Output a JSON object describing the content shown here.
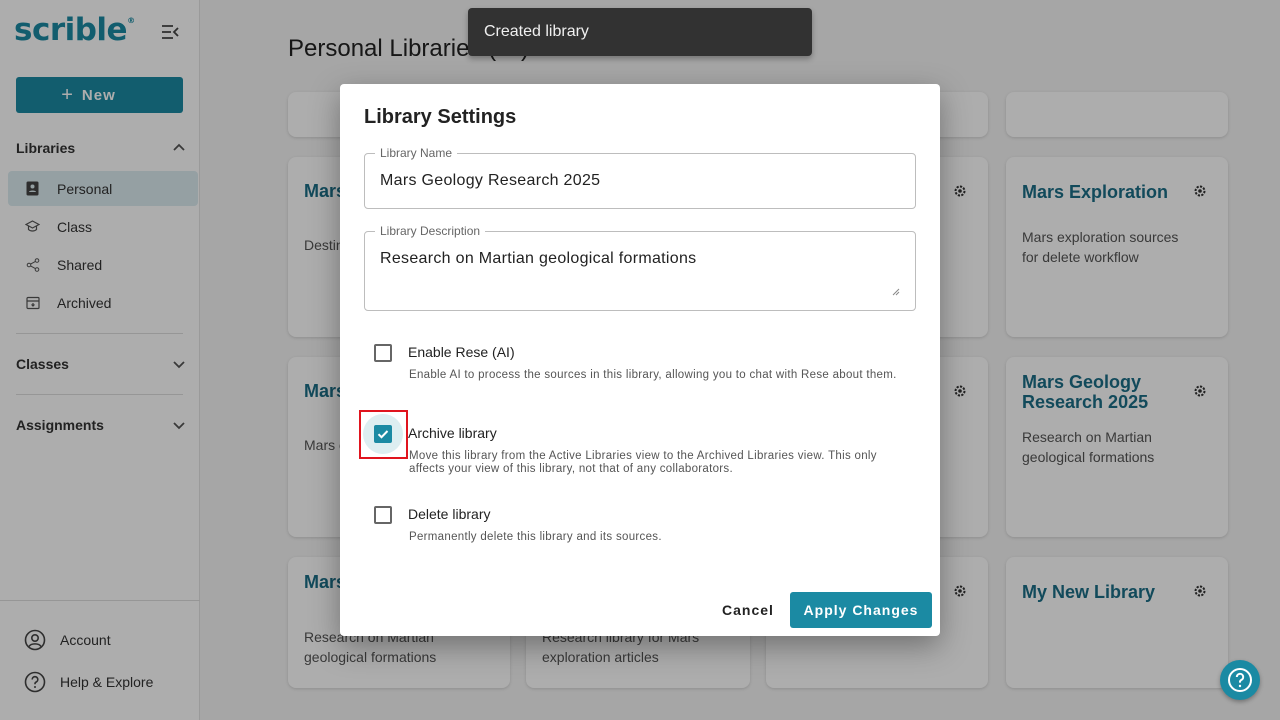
{
  "sidebar": {
    "logo": "scrible",
    "logo_mark": "®",
    "new_label": "New",
    "libraries_heading": "Libraries",
    "library_items": [
      {
        "label": "Personal"
      },
      {
        "label": "Class"
      },
      {
        "label": "Shared"
      },
      {
        "label": "Archived"
      }
    ],
    "classes_heading": "Classes",
    "assignments_heading": "Assignments",
    "account_label": "Account",
    "help_label": "Help & Explore"
  },
  "main": {
    "page_title": "Personal Libraries (11)",
    "cards": [
      {
        "title": "Mars",
        "desc": "Destin... source..."
      },
      {
        "title": "Mars Exploration",
        "desc": "Mars exploration sources for delete workflow"
      },
      {
        "title": "Mars",
        "desc": "Mars o... for del..."
      },
      {
        "title": "Mars Geology Research 2025",
        "desc": "Research on Martian geological formations"
      },
      {
        "title": "Mars Rese",
        "desc": "Research on Martian geological formations"
      },
      {
        "title": "",
        "desc": "Research library for Mars exploration articles"
      },
      {
        "title": "My New Library",
        "desc": ""
      }
    ]
  },
  "snackbar": {
    "text": "Created library"
  },
  "dialog": {
    "title": "Library Settings",
    "name_label": "Library Name",
    "name_value": "Mars Geology Research 2025",
    "desc_label": "Library Description",
    "desc_value": "Research on Martian geological formations",
    "options": [
      {
        "label": "Enable Rese (AI)",
        "desc": "Enable AI to process the sources in this library, allowing you to chat with Rese about them.",
        "checked": false
      },
      {
        "label": "Archive library",
        "desc": "Move this library from the Active Libraries view to the Archived Libraries view. This only affects your view of this library, not that of any collaborators.",
        "checked": true
      },
      {
        "label": "Delete library",
        "desc": "Permanently delete this library and its sources.",
        "checked": false
      }
    ],
    "cancel_label": "Cancel",
    "apply_label": "Apply Changes"
  },
  "colors": {
    "accent": "#1b8aa3",
    "highlight": "#e0141e"
  }
}
